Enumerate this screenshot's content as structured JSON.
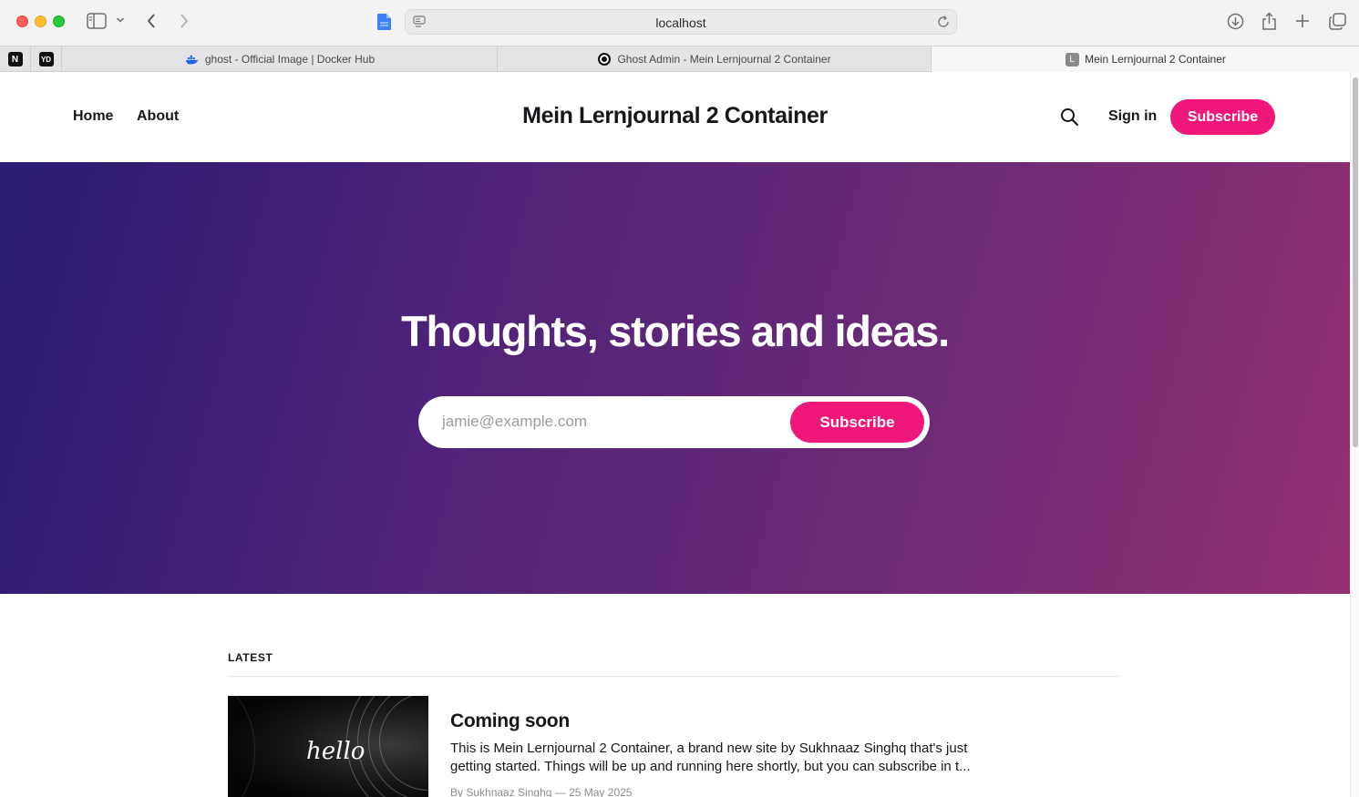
{
  "browser": {
    "url": "localhost",
    "tabs": [
      {
        "label": "ghost - Official Image | Docker Hub",
        "icon": "docker-icon"
      },
      {
        "label": "Ghost Admin - Mein Lernjournal 2 Container",
        "icon": "ghost-icon"
      },
      {
        "label": "Mein Lernjournal 2 Container",
        "icon": "site-letter-icon",
        "favicon_letter": "L",
        "active": true
      }
    ],
    "pinned_tabs": [
      {
        "icon": "notion-icon",
        "glyph": "N"
      },
      {
        "icon": "app-icon",
        "glyph": "YD"
      }
    ]
  },
  "site": {
    "title": "Mein Lernjournal 2 Container",
    "nav": [
      {
        "label": "Home"
      },
      {
        "label": "About"
      }
    ],
    "signin_label": "Sign in",
    "subscribe_label": "Subscribe",
    "accent_color": "#f0177a"
  },
  "hero": {
    "title": "Thoughts, stories and ideas.",
    "email_placeholder": "jamie@example.com",
    "subscribe_label": "Subscribe"
  },
  "feed": {
    "section_label": "LATEST",
    "posts": [
      {
        "title": "Coming soon",
        "image_text": "hello",
        "excerpt": "This is Mein Lernjournal 2 Container, a brand new site by Sukhnaaz Singhq that's just getting started. Things will be up and running here shortly, but you can subscribe in t...",
        "meta": "By Sukhnaaz Singhq — 25 May 2025"
      }
    ]
  }
}
